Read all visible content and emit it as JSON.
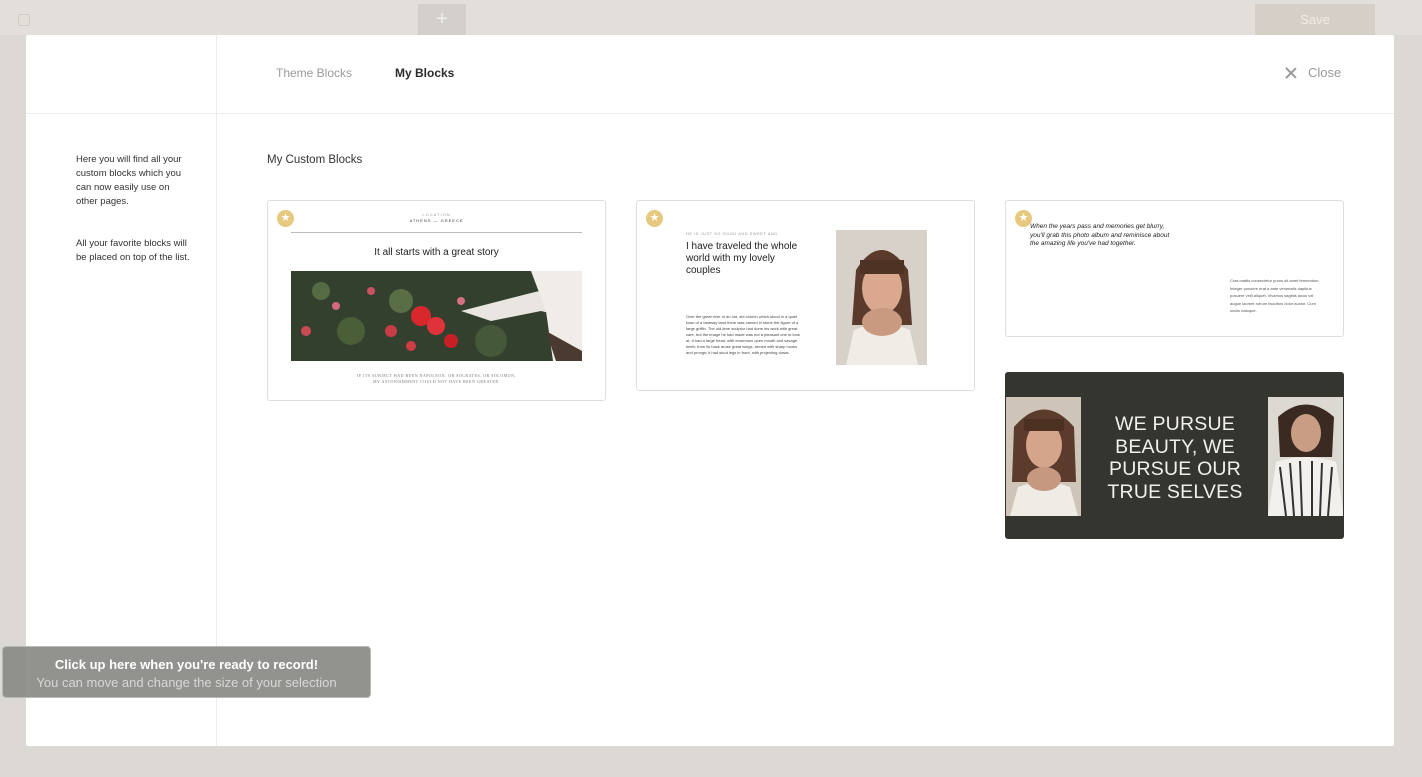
{
  "backdrop": {
    "save_label": "Save",
    "plus_label": "+"
  },
  "header": {
    "tabs": [
      {
        "label": "Theme Blocks",
        "active": false
      },
      {
        "label": "My Blocks",
        "active": true
      }
    ],
    "close_label": "Close"
  },
  "sidebar": {
    "paragraph1": "Here you will find all your custom blocks which you can now easily use on other pages.",
    "paragraph2": "All your favorite blocks will be placed on top of the list."
  },
  "main": {
    "section_title": "My Custom Blocks",
    "cards": [
      {
        "favorite": true,
        "kicker": "LOCATION",
        "sub": "ATHENS — GREECE",
        "headline": "It all starts with a great story",
        "caption_line1": "IF ITS SUBJECT HAD BEEN NAPOLEON, OR SOCRATES, OR SOLOMON,",
        "caption_line2": "MY ASTONISHMENT COULD NOT HAVE BEEN GREATER."
      },
      {
        "favorite": true,
        "kicker": "HE IS JUST SO GOOD AND SWEET AND",
        "headline": "I have traveled the whole world with my lovely couples",
        "body": "Over the great river of an old, old church which stood in a quiet town of a faraway land there was carved in stone the figure of a large griffin. The old-time sculptor had done his work with great care, but the image he had made was not a pleasant one to look at. It had a large head, with enormous open mouth and savage teeth; from its back arose great wings, armed with sharp hooks and prongs; it had stout legs in front, with projecting claws."
      },
      {
        "favorite": true,
        "quote": "When the years pass and memories get blurry, you'll grab this photo album and reminisce about the amazing life you've had together.",
        "body": "Cras mattis consectetur purus sit amet fermentum. Integer posuere erat a ante venenatis dapibus posuere velit aliquet. Vivamus sagittis lacus vel augue laoreet rutrum faucibus dolor auctor. Cum sociis natoque."
      },
      {
        "favorite": false,
        "headline": "WE PURSUE BEAUTY, WE PURSUE OUR TRUE SELVES"
      }
    ]
  },
  "recording_tip": {
    "title": "Click up here when you're ready to record!",
    "subtitle": "You can move and change the size of your selection"
  },
  "colors": {
    "favorite_star": "#e6c97e",
    "dark_block": "#35352f",
    "backdrop": "#dcd9d4"
  }
}
